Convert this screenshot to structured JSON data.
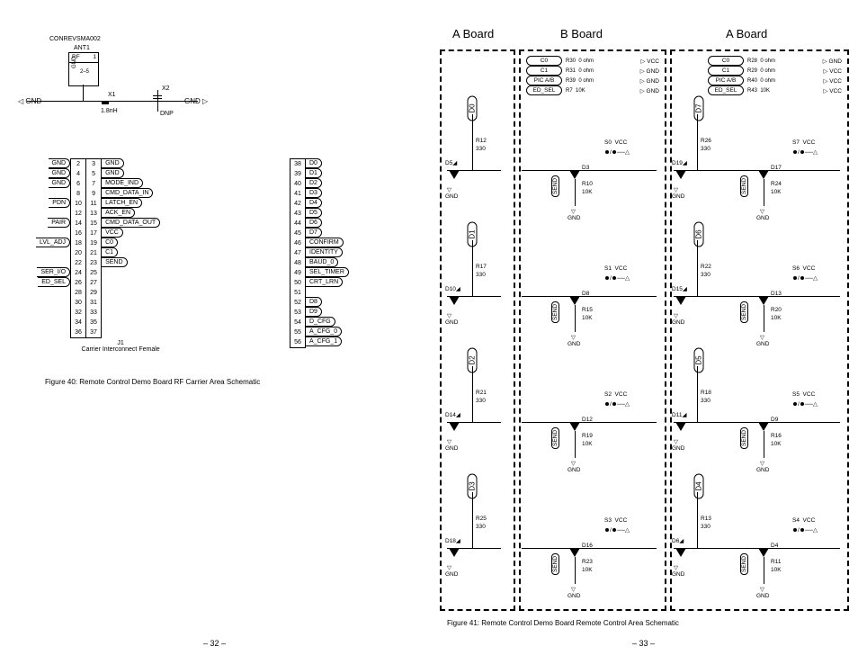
{
  "left": {
    "top_label": "CONREVSMA002",
    "ant1": "ANT1",
    "ant_pin": "1",
    "rf": "RF",
    "gnd_v_pins": "2–5",
    "x1": "X1",
    "x2": "X2",
    "x_val": "1.8nH",
    "dnp": "DNP",
    "j1_pins_left": [
      {
        "n": "2",
        "sig": "GND"
      },
      {
        "n": "4",
        "sig": "GND"
      },
      {
        "n": "6",
        "sig": "GND"
      },
      {
        "n": "8",
        "sig": ""
      },
      {
        "n": "10",
        "sig": "PDN"
      },
      {
        "n": "12",
        "sig": ""
      },
      {
        "n": "14",
        "sig": "PAIR"
      },
      {
        "n": "16",
        "sig": ""
      },
      {
        "n": "18",
        "sig": "LVL_ADJ"
      },
      {
        "n": "20",
        "sig": ""
      },
      {
        "n": "22",
        "sig": ""
      },
      {
        "n": "24",
        "sig": "SER_I/O"
      },
      {
        "n": "26",
        "sig": "ED_SEL"
      },
      {
        "n": "28",
        "sig": ""
      },
      {
        "n": "30",
        "sig": ""
      },
      {
        "n": "32",
        "sig": ""
      },
      {
        "n": "34",
        "sig": ""
      },
      {
        "n": "36",
        "sig": ""
      }
    ],
    "j1_pins_right": [
      {
        "n": "3",
        "sig": "GND"
      },
      {
        "n": "5",
        "sig": "GND"
      },
      {
        "n": "7",
        "sig": "MODE_IND"
      },
      {
        "n": "9",
        "sig": "CMD_DATA_IN"
      },
      {
        "n": "11",
        "sig": "LATCH_EN"
      },
      {
        "n": "13",
        "sig": "ACK_EN"
      },
      {
        "n": "15",
        "sig": "CMD_DATA_OUT"
      },
      {
        "n": "17",
        "sig": "VCC"
      },
      {
        "n": "19",
        "sig": "C0"
      },
      {
        "n": "21",
        "sig": "C1"
      },
      {
        "n": "23",
        "sig": "SEND"
      },
      {
        "n": "25",
        "sig": ""
      },
      {
        "n": "27",
        "sig": ""
      },
      {
        "n": "29",
        "sig": ""
      },
      {
        "n": "31",
        "sig": ""
      },
      {
        "n": "33",
        "sig": ""
      },
      {
        "n": "35",
        "sig": ""
      },
      {
        "n": "37",
        "sig": ""
      }
    ],
    "j1_footer": "J1",
    "j1_desc": "Carrier  Interconnect  Female",
    "j2_pins": [
      {
        "n": "38",
        "sig": "D0"
      },
      {
        "n": "39",
        "sig": "D1"
      },
      {
        "n": "40",
        "sig": "D2"
      },
      {
        "n": "41",
        "sig": "D3"
      },
      {
        "n": "42",
        "sig": "D4"
      },
      {
        "n": "43",
        "sig": "D5"
      },
      {
        "n": "44",
        "sig": "D6"
      },
      {
        "n": "45",
        "sig": "D7"
      },
      {
        "n": "46",
        "sig": "CONFIRM"
      },
      {
        "n": "47",
        "sig": "IDENTITY"
      },
      {
        "n": "48",
        "sig": "BAUD_0"
      },
      {
        "n": "49",
        "sig": "SEL_TIMER"
      },
      {
        "n": "50",
        "sig": "CRT_LRN"
      },
      {
        "n": "51",
        "sig": ""
      },
      {
        "n": "52",
        "sig": "D8"
      },
      {
        "n": "53",
        "sig": "D9"
      },
      {
        "n": "54",
        "sig": "D_CFG"
      },
      {
        "n": "55",
        "sig": "A_CFG_0"
      },
      {
        "n": "56",
        "sig": "A_CFG_1"
      }
    ],
    "gnd": "GND",
    "fig40": "Figure 40: Remote Control Demo Board RF Carrier Area Schematic",
    "pg": "– 32 –"
  },
  "right": {
    "boards": [
      "A  Board",
      "B  Board",
      "A  Board"
    ],
    "top_b": [
      {
        "sig": "C0",
        "r": "R30",
        "v": "0 ohm",
        "net": "VCC"
      },
      {
        "sig": "C1",
        "r": "R31",
        "v": "0 ohm",
        "net": "GND"
      },
      {
        "sig": "PIC A/B",
        "r": "R39",
        "v": "0 ohm",
        "net": "GND"
      },
      {
        "sig": "ED_SEL",
        "r": "R7",
        "v": "10K",
        "net": "GND"
      }
    ],
    "top_a2": [
      {
        "sig": "C0",
        "r": "R28",
        "v": "0 ohm",
        "net": "GND"
      },
      {
        "sig": "C1",
        "r": "R29",
        "v": "0 ohm",
        "net": "VCC"
      },
      {
        "sig": "PIC A/B",
        "r": "R40",
        "v": "0 ohm",
        "net": "VCC"
      },
      {
        "sig": "ED_SEL",
        "r": "R43",
        "v": "10K",
        "net": "VCC"
      }
    ],
    "rows": [
      {
        "a_data": "D0",
        "a_r": "R12",
        "a_r_v": "330",
        "a_led": "D5",
        "b_sw": "S0",
        "b_alt_led": "D3",
        "b_rpull": "R10",
        "b_rpull_v": "10K",
        "a2_data": "D7",
        "a2_r": "R26",
        "a2_r_v": "330",
        "a2_led": "D19",
        "a2_sw": "S7",
        "a2_alt_led": "D17",
        "a2_rpull": "R24",
        "a2_rpull_v": "10K"
      },
      {
        "a_data": "D1",
        "a_r": "R17",
        "a_r_v": "330",
        "a_led": "D10",
        "b_sw": "S1",
        "b_alt_led": "D8",
        "b_rpull": "R15",
        "b_rpull_v": "10K",
        "a2_data": "D6",
        "a2_r": "R22",
        "a2_r_v": "330",
        "a2_led": "D15",
        "a2_sw": "S6",
        "a2_alt_led": "D13",
        "a2_rpull": "R20",
        "a2_rpull_v": "10K"
      },
      {
        "a_data": "D2",
        "a_r": "R21",
        "a_r_v": "330",
        "a_led": "D14",
        "b_sw": "S2",
        "b_alt_led": "D12",
        "b_rpull": "R19",
        "b_rpull_v": "10K",
        "a2_data": "D5",
        "a2_r": "R18",
        "a2_r_v": "330",
        "a2_led": "D11",
        "a2_sw": "S5",
        "a2_alt_led": "D9",
        "a2_rpull": "R16",
        "a2_rpull_v": "10K"
      },
      {
        "a_data": "D3",
        "a_r": "R25",
        "a_r_v": "330",
        "a_led": "D18",
        "b_sw": "S3",
        "b_alt_led": "D16",
        "b_rpull": "R23",
        "b_rpull_v": "10K",
        "a2_data": "D4",
        "a2_r": "R13",
        "a2_r_v": "330",
        "a2_led": "D6",
        "a2_sw": "S4",
        "a2_alt_led": "D4",
        "a2_rpull": "R11",
        "a2_rpull_v": "10K"
      }
    ],
    "send": "SEND",
    "vcc": "VCC",
    "gnd": "GND",
    "fig41": "Figure 41: Remote Control Demo Board Remote Control Area Schematic",
    "pg": "– 33 –"
  }
}
